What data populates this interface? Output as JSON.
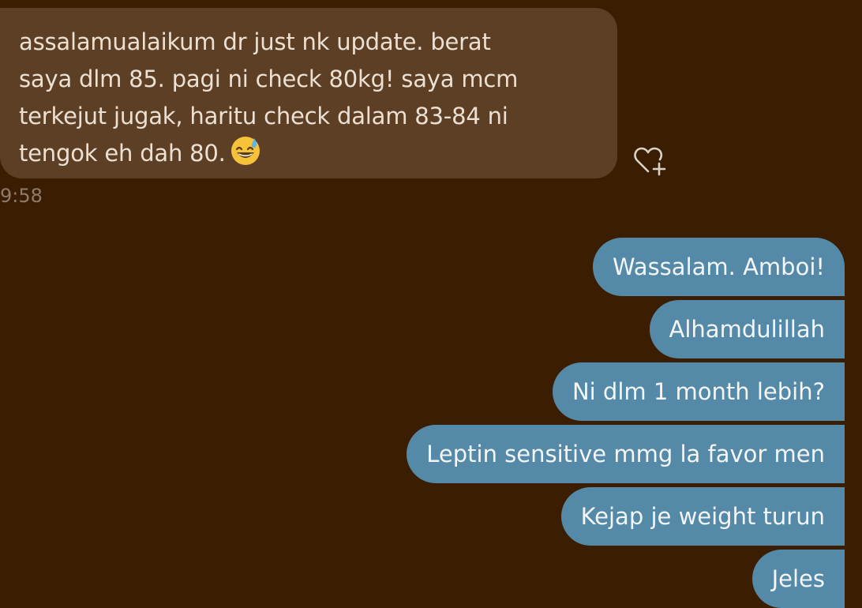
{
  "incoming_message": {
    "text": "assalamualaikum dr just nk update. berat\nsaya dlm 85. pagi ni check 80kg! saya mcm\nterkejut jugak, haritu check dalam 83-84 ni\ntengok eh dah 80.",
    "emoji": "grinning-face-with-sweat-emoji",
    "time": "9:58",
    "react_icon": "heart-plus-icon"
  },
  "outgoing_messages": [
    {
      "text": "Wassalam.  Amboi!"
    },
    {
      "text": "Alhamdulillah"
    },
    {
      "text": "Ni dlm 1 month lebih?"
    },
    {
      "text": "Leptin sensitive mmg la favor men"
    },
    {
      "text": "Kejap je weight turun"
    },
    {
      "text": "Jeles"
    }
  ],
  "colors": {
    "background": "#3b1e02",
    "incoming_bubble": "#5d3f26",
    "outgoing_bubble": "#548aa8",
    "timestamp": "#8f7b69"
  }
}
